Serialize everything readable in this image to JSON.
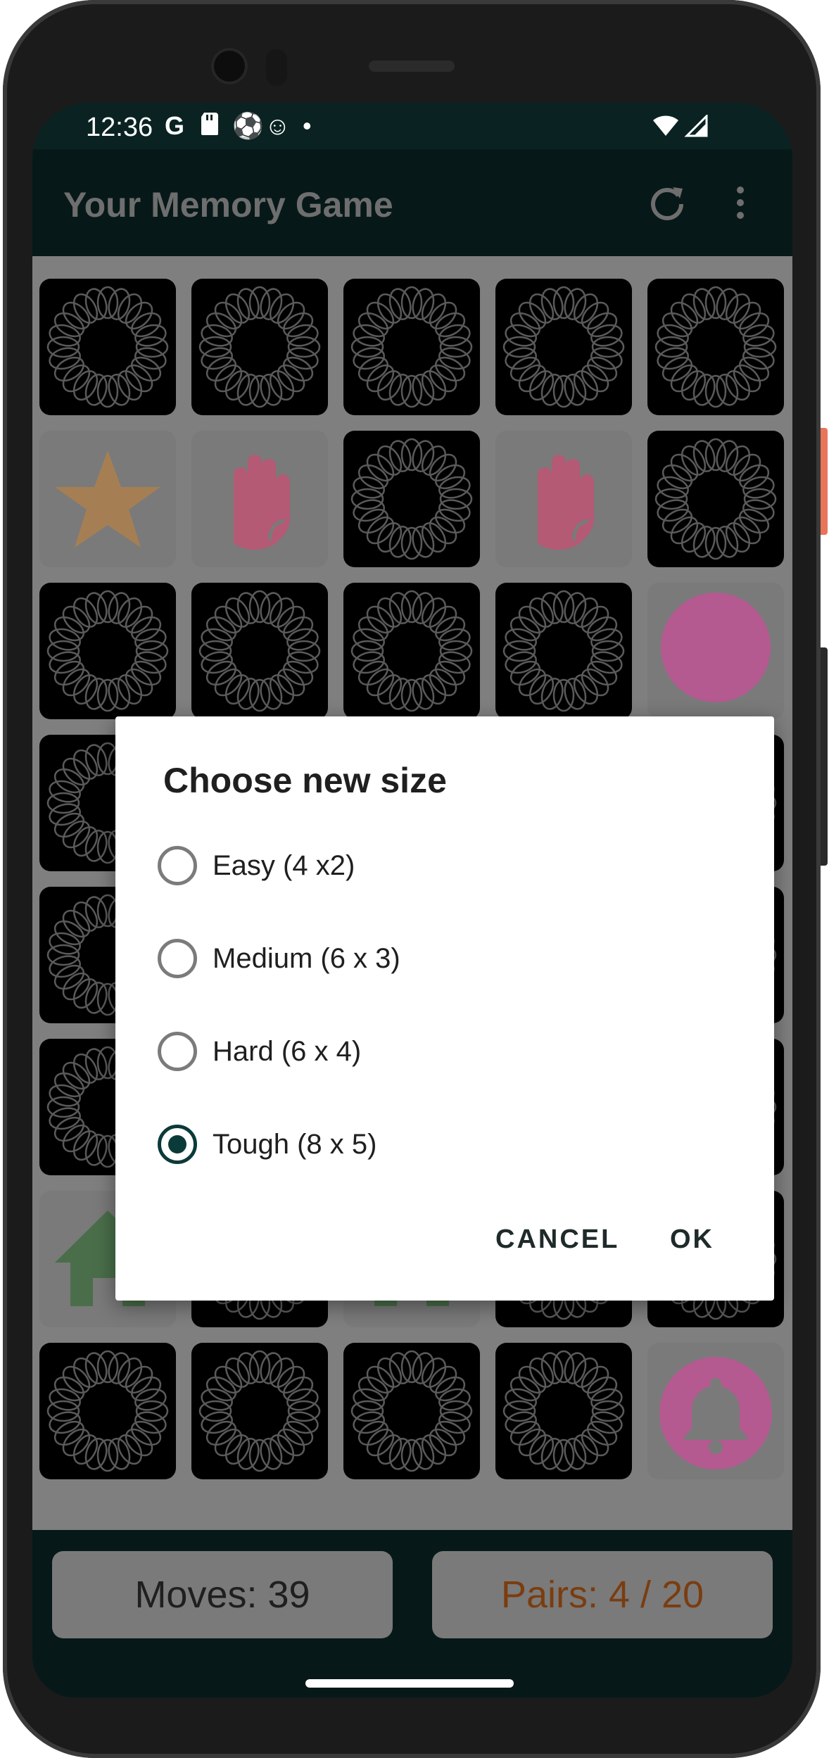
{
  "status_bar": {
    "time": "12:36",
    "left_icons": [
      "google-icon",
      "sd-card-icon",
      "soccer-ball-icon",
      "smiley-icon",
      "dot-icon"
    ],
    "right_icons": [
      "wifi-icon",
      "signal-icon"
    ]
  },
  "app_bar": {
    "title": "Your Memory Game",
    "refresh_icon": "refresh-icon",
    "menu_icon": "more-vert-icon"
  },
  "board": {
    "rows": [
      [
        "back",
        "back",
        "back",
        "back",
        "back"
      ],
      [
        "star",
        "hand",
        "back",
        "hand",
        "back"
      ],
      [
        "back",
        "back",
        "back",
        "back",
        "pink-circle"
      ],
      [
        "back",
        "back",
        "back",
        "back",
        "back"
      ],
      [
        "back",
        "back",
        "back",
        "back",
        "back"
      ],
      [
        "back",
        "back",
        "back",
        "back",
        "back"
      ],
      [
        "house",
        "back",
        "house",
        "back",
        "back"
      ],
      [
        "back",
        "back",
        "back",
        "back",
        "bell"
      ]
    ]
  },
  "counters": {
    "moves": "Moves: 39",
    "pairs": "Pairs: 4 / 20",
    "moves_color": "#1f1f1f",
    "pairs_color": "#7a3d10"
  },
  "dialog": {
    "title": "Choose new size",
    "options": [
      {
        "label": "Easy (4 x2)",
        "checked": false
      },
      {
        "label": "Medium (6 x 3)",
        "checked": false
      },
      {
        "label": "Hard (6 x 4)",
        "checked": false
      },
      {
        "label": "Tough (8 x 5)",
        "checked": true
      }
    ],
    "cancel_label": "CANCEL",
    "ok_label": "OK"
  },
  "colors": {
    "accent": "#0b3a3a",
    "star": "#a57f53",
    "hand": "#b45a74",
    "house": "#4a6e4a",
    "pink": "#b45a90"
  }
}
